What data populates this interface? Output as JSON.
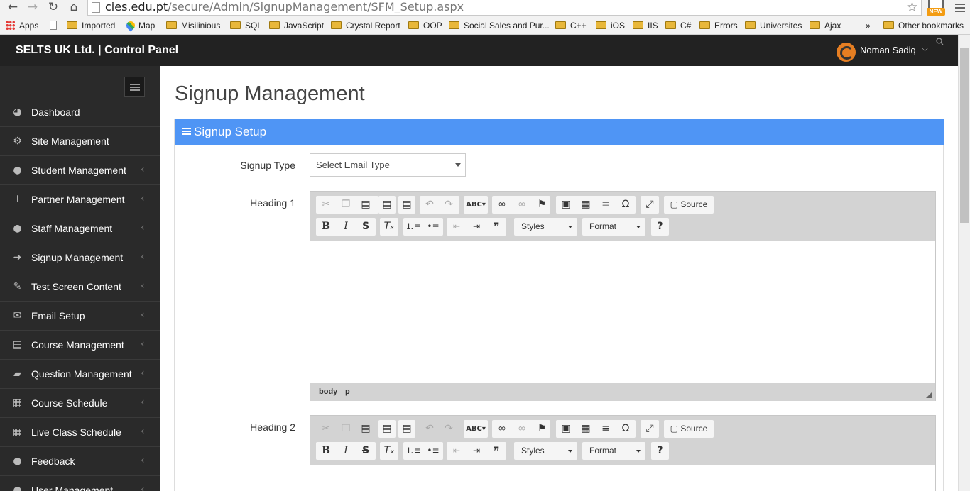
{
  "browser": {
    "url_host": "cies.edu.pt",
    "url_path": "/secure/Admin/SignupManagement/SFM_Setup.aspx",
    "new_badge": "NEW",
    "bookmarks": [
      "Apps",
      "Imported",
      "Map",
      "Misilinious",
      "SQL",
      "JavaScript",
      "Crystal Report",
      "OOP",
      "Social Sales and Pur...",
      "C++",
      "iOS",
      "IIS",
      "C#",
      "Errors",
      "Universites",
      "Ajax"
    ],
    "overflow": "»",
    "other_bookmarks": "Other bookmarks"
  },
  "header": {
    "brand": "SELTS UK Ltd. | Control Panel",
    "user_name": "Noman Sadiq"
  },
  "sidebar": {
    "items": [
      {
        "label": "Dashboard",
        "icon": "dashboard-icon"
      },
      {
        "label": "Site Management",
        "icon": "cogs-icon"
      },
      {
        "label": "Student Management",
        "icon": "user-icon"
      },
      {
        "label": "Partner Management",
        "icon": "sitemap-icon"
      },
      {
        "label": "Staff Management",
        "icon": "users-icon"
      },
      {
        "label": "Signup Management",
        "icon": "sign-in-icon"
      },
      {
        "label": "Test Screen Content",
        "icon": "edit-icon"
      },
      {
        "label": "Email Setup",
        "icon": "envelope-icon"
      },
      {
        "label": "Course Management",
        "icon": "book-icon"
      },
      {
        "label": "Question Management",
        "icon": "folder-open-icon"
      },
      {
        "label": "Course Schedule",
        "icon": "calendar-icon"
      },
      {
        "label": "Live Class Schedule",
        "icon": "calendar-icon"
      },
      {
        "label": "Feedback",
        "icon": "comments-icon"
      },
      {
        "label": "User Management",
        "icon": "users-icon"
      }
    ]
  },
  "main": {
    "page_title": "Signup Management",
    "panel_title": "Signup Setup",
    "signup_type_label": "Signup Type",
    "signup_type_value": "Select Email Type",
    "heading1_label": "Heading 1",
    "heading2_label": "Heading 2"
  },
  "editor": {
    "source_label": "Source",
    "styles_label": "Styles",
    "format_label": "Format",
    "path_body": "body",
    "path_p": "p"
  }
}
